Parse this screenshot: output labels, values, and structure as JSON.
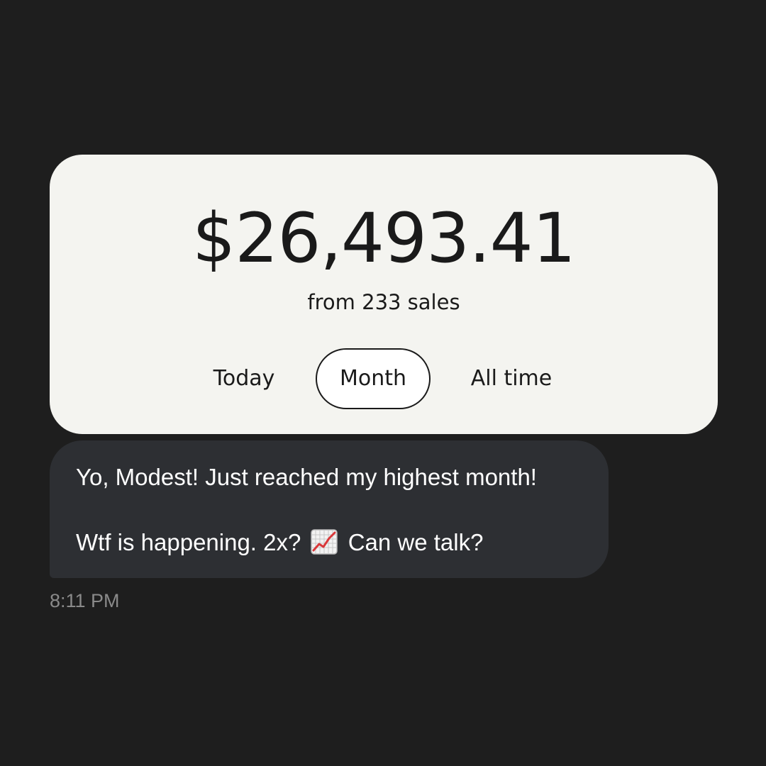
{
  "sales_card": {
    "amount": "$26,493.41",
    "subtitle": "from 233 sales",
    "tabs": [
      {
        "label": "Today",
        "selected": false
      },
      {
        "label": "Month",
        "selected": true
      },
      {
        "label": "All time",
        "selected": false
      }
    ]
  },
  "message": {
    "line1": "Yo, Modest!  Just reached my highest month!",
    "line2_before": "Wtf is happening. 2x?",
    "line2_icon": "chart-increasing-icon",
    "line2_after": "Can we talk?",
    "timestamp": "8:11 PM"
  },
  "colors": {
    "background": "#1e1e1e",
    "card": "#f4f4f0",
    "bubble": "#2d2f33",
    "timestamp": "#8a8a8a",
    "chart_line": "#d9383a"
  }
}
